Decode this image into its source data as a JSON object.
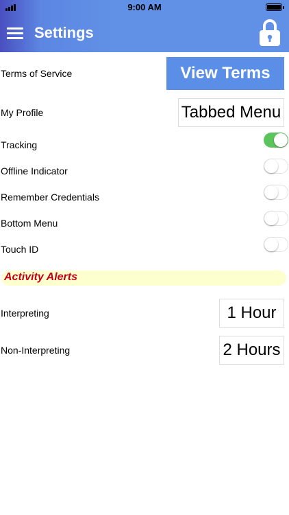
{
  "status_bar": {
    "time": "9:00 AM"
  },
  "header": {
    "title": "Settings"
  },
  "settings": {
    "terms_of_service": {
      "label": "Terms of Service",
      "button": "View Terms"
    },
    "my_profile": {
      "label": "My Profile",
      "value": "Tabbed Menu"
    },
    "toggles": [
      {
        "label": "Tracking",
        "on": true
      },
      {
        "label": "Offline Indicator",
        "on": false
      },
      {
        "label": "Remember Credentials",
        "on": false
      },
      {
        "label": "Bottom Menu",
        "on": false
      },
      {
        "label": "Touch ID",
        "on": false
      }
    ]
  },
  "activity_alerts": {
    "title": "Activity Alerts",
    "items": [
      {
        "label": "Interpreting",
        "value": "1 Hour"
      },
      {
        "label": "Non-Interpreting",
        "value": "2 Hours"
      }
    ]
  },
  "colors": {
    "header_blue": "#6191e6",
    "toggle_on": "#5cc45c",
    "alert_title": "#c0001a",
    "alert_bar": "#feffce"
  },
  "icons": [
    "menu-icon",
    "lock-icon",
    "signal-icon",
    "battery-icon"
  ]
}
